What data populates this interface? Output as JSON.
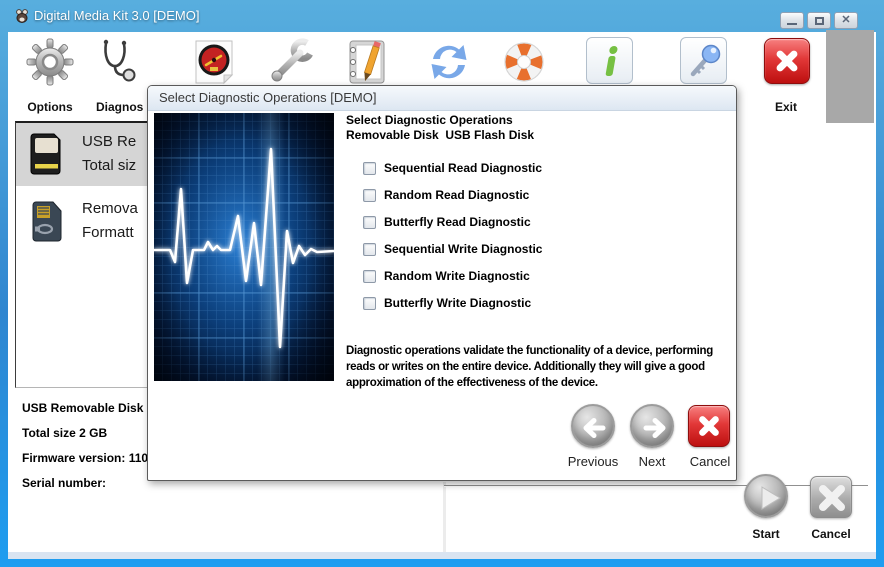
{
  "window": {
    "title": "Digital Media Kit 3.0 [DEMO]",
    "control_icons": [
      "minimize-icon",
      "maximize-icon",
      "close-icon"
    ]
  },
  "toolbar": {
    "options_label": "Options",
    "diagnostics_label": "Diagnos",
    "exit_label": "Exit",
    "icons": [
      "gear-icon",
      "stethoscope-icon",
      "gauge-icon",
      "wrench-icon",
      "notepad-icon",
      "refresh-icon",
      "lifebuoy-icon",
      "info-icon",
      "key-icon",
      "exit-icon"
    ]
  },
  "device_list": {
    "items": [
      {
        "icon": "usb-flash-drive-icon",
        "line1": "USB Re",
        "line2": "Total siz",
        "selected": true
      },
      {
        "icon": "sd-card-icon",
        "line1": "Remova",
        "line2": "Formatt",
        "selected": false
      }
    ]
  },
  "device_info": {
    "line1": "USB Removable Disk U",
    "line2": "Total size 2 GB",
    "line3": "Firmware version: 110",
    "line4": "Serial number:"
  },
  "main_actions": {
    "start_label": "Start",
    "cancel_label": "Cancel"
  },
  "dialog": {
    "title": "Select Diagnostic Operations [DEMO]",
    "heading_line1": "Select Diagnostic Operations",
    "heading_line2": "Removable Disk  USB Flash Disk",
    "checkboxes": [
      {
        "label": "Sequential Read Diagnostic",
        "checked": false
      },
      {
        "label": "Random Read Diagnostic",
        "checked": false
      },
      {
        "label": "Butterfly Read Diagnostic",
        "checked": false
      },
      {
        "label": "Sequential Write Diagnostic",
        "checked": false
      },
      {
        "label": "Random Write Diagnostic",
        "checked": false
      },
      {
        "label": "Butterfly Write Diagnostic",
        "checked": false
      }
    ],
    "description": "Diagnostic operations validate the functionality of a device, performing reads or writes on the entire device. Additionally they will give a good approximation of the effectiveness of the device.",
    "previous_label": "Previous",
    "next_label": "Next",
    "cancel_label": "Cancel"
  },
  "colors": {
    "window_border_blue": "#2f86d0",
    "bottom_border_blue": "#1e9df0",
    "exit_red": "#cc1111",
    "info_green": "#76c043",
    "key_blue": "#8ab6f4",
    "ekg_blue": "#2a7fd4",
    "selected_item_gray": "#d5d5d5"
  }
}
